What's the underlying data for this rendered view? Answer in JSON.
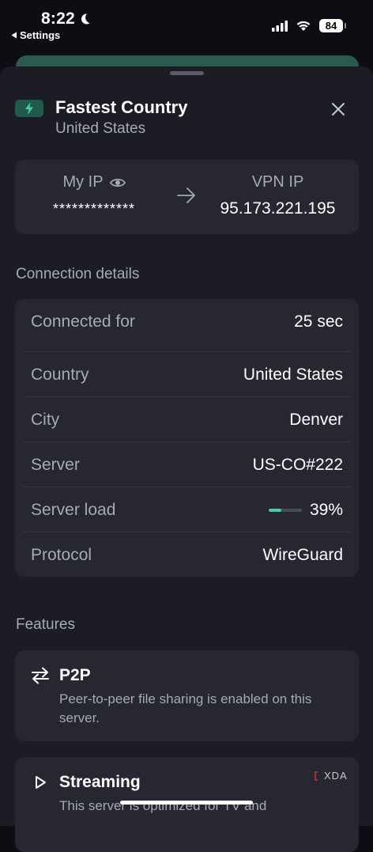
{
  "status_bar": {
    "time": "8:22",
    "back_label": "Settings",
    "battery": "84"
  },
  "header": {
    "title": "Fastest Country",
    "subtitle": "United States"
  },
  "ip_card": {
    "my_ip_label": "My IP",
    "my_ip_value": "*************",
    "vpn_ip_label": "VPN IP",
    "vpn_ip_value": "95.173.221.195"
  },
  "connection_details": {
    "section_title": "Connection details",
    "rows": [
      {
        "key": "Connected for",
        "value": "25 sec"
      },
      {
        "key": "Country",
        "value": "United States"
      },
      {
        "key": "City",
        "value": "Denver"
      },
      {
        "key": "Server",
        "value": "US-CO#222"
      },
      {
        "key": "Server load",
        "value": "39%"
      },
      {
        "key": "Protocol",
        "value": "WireGuard"
      }
    ],
    "server_load_fraction": 0.39
  },
  "features": {
    "section_title": "Features",
    "items": [
      {
        "title": "P2P",
        "description": "Peer-to-peer file sharing is enabled on this server.",
        "icon": "swap-arrows-icon"
      },
      {
        "title": "Streaming",
        "description": "This server is optimized for TV and",
        "icon": "play-icon"
      }
    ]
  },
  "watermark": "XDA",
  "colors": {
    "accent": "#4ac9a3",
    "sheet": "#1b1c24",
    "card": "#262730"
  }
}
